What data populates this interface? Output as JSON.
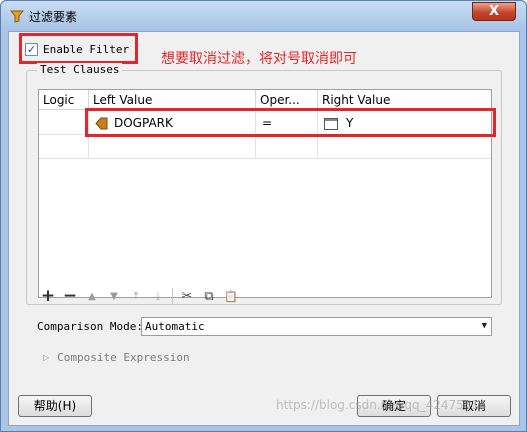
{
  "window": {
    "title": "过滤要素",
    "close_symbol": "X"
  },
  "filter": {
    "enable_label": "Enable Filter",
    "enabled": true,
    "check_mark": "✓"
  },
  "annotation": {
    "text": "想要取消过滤，将对号取消即可",
    "color": "#e3262a"
  },
  "clauses": {
    "group_title": "Test Clauses",
    "columns": [
      "Logic",
      "Left Value",
      "Oper...",
      "Right Value"
    ],
    "rows": [
      {
        "logic": "",
        "left_value": "DOGPARK",
        "operator": "=",
        "right_value": "Y"
      }
    ]
  },
  "toolbar": {
    "add": "+",
    "remove": "−",
    "move_up": "▲",
    "move_down": "▼",
    "move_top": "⤒",
    "move_bottom": "⤓",
    "cut": "✂",
    "copy": "⧉",
    "paste": "📋"
  },
  "comparison": {
    "label": "Comparison Mode:",
    "value": "Automatic",
    "arrow": "▼"
  },
  "composite": {
    "label": "Composite Expression",
    "expander": "▷"
  },
  "buttons": {
    "help": "帮助(H)",
    "ok": "确定",
    "cancel": "取消"
  },
  "watermark": "https://blog.csdn.net/qq_42475814"
}
